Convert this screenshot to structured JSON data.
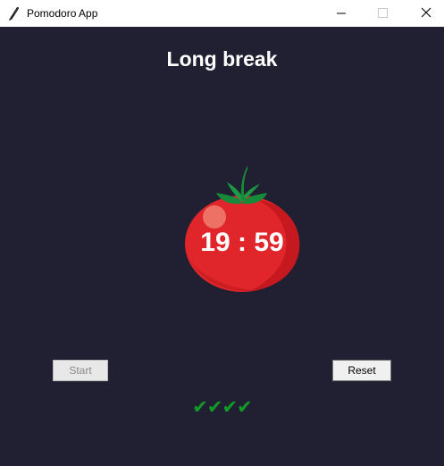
{
  "window": {
    "title": "Pomodoro App"
  },
  "session": {
    "mode_label": "Long break"
  },
  "timer": {
    "display": "19 : 59"
  },
  "controls": {
    "start_label": "Start",
    "start_enabled": false,
    "reset_label": "Reset"
  },
  "progress": {
    "completed_sessions": 4,
    "checkmarks": "✔✔✔✔"
  },
  "colors": {
    "background": "#211f32",
    "title_text": "#ffffff",
    "tomato_red": "#e0262b",
    "tomato_leaf": "#2e8b2e",
    "checkmark_green": "#119a26"
  },
  "icons": {
    "app_icon": "feather-icon",
    "tomato_image": "tomato-icon"
  }
}
